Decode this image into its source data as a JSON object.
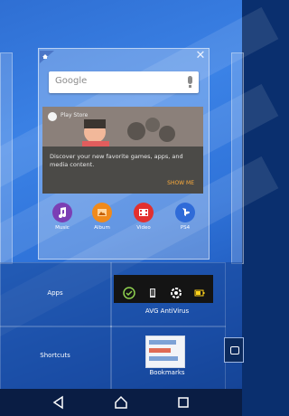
{
  "search": {
    "placeholder": "Google"
  },
  "card": {
    "top_label": "Play Store",
    "text": "Discover your new favorite games, apps, and media content.",
    "action": "SHOW ME"
  },
  "featured_apps": [
    {
      "label": "Music",
      "icon": "music-icon",
      "color": "#7b3fb4"
    },
    {
      "label": "Album",
      "icon": "album-icon",
      "color": "#f08a1c"
    },
    {
      "label": "Video",
      "icon": "video-icon",
      "color": "#e2302f"
    },
    {
      "label": "PS4",
      "icon": "playstation-icon",
      "color": "#2f6bd8"
    }
  ],
  "tiles": {
    "apps": "Apps",
    "avg": "AVG AntiVirus",
    "shortcuts": "Shortcuts",
    "bookmarks": "Bookmarks"
  },
  "navigation": {
    "back": "back-icon",
    "home": "home-icon",
    "recents": "recents-icon"
  }
}
